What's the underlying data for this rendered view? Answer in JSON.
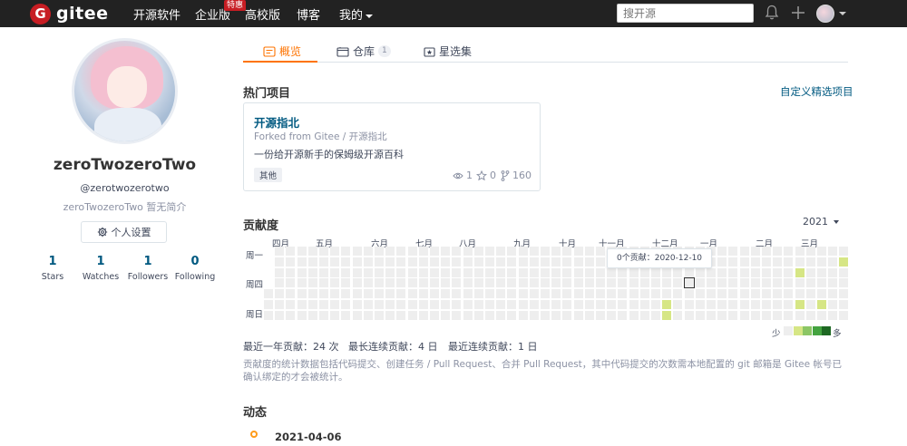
{
  "nav": {
    "logo_mark": "G",
    "logo_text": "gitee",
    "items": [
      "开源软件",
      "企业版",
      "高校版",
      "博客"
    ],
    "badge": "特惠",
    "mine": "我的",
    "search_placeholder": "搜开源"
  },
  "profile": {
    "name": "zeroTwozeroTwo",
    "handle": "@zerotwozerotwo",
    "bio": "zeroTwozeroTwo 暂无简介",
    "settings_label": "个人设置",
    "stats": [
      {
        "num": "1",
        "label": "Stars"
      },
      {
        "num": "1",
        "label": "Watches"
      },
      {
        "num": "1",
        "label": "Followers"
      },
      {
        "num": "0",
        "label": "Following"
      }
    ]
  },
  "tabs": {
    "overview": "概览",
    "repos": "仓库",
    "repos_count": "1",
    "collections": "星选集"
  },
  "hot": {
    "title": "热门项目",
    "custom_link": "自定义精选项目",
    "project": {
      "name": "开源指北",
      "fork": "Forked from Gitee  / 开源指北",
      "desc": "一份给开源新手的保姆级开源百科",
      "tag": "其他",
      "watches": "1",
      "stars": "0",
      "forks": "160"
    }
  },
  "contrib": {
    "title": "贡献度",
    "year": "2021",
    "months": [
      "四月",
      "五月",
      "六月",
      "七月",
      "八月",
      "九月",
      "十月",
      "十一月",
      "十二月",
      "一月",
      "二月",
      "三月"
    ],
    "weekdays": [
      "周一",
      "周四",
      "周日"
    ],
    "tooltip": "0个贡献：2020-12-10",
    "legend_less": "少",
    "legend_more": "多",
    "levels": [
      "#eeeeee",
      "#d6e685",
      "#8cc665",
      "#44a340",
      "#1e6823"
    ],
    "year_total": "最近一年贡献：24 次",
    "longest": "最长连续贡献：4 日",
    "current": "最近连续贡献：1 日",
    "note": "贡献度的统计数据包括代码提交、创建任务 / Pull Request、合并 Pull Request，其中代码提交的次数需本地配置的 git 邮箱是 Gitee 帐号已确认绑定的才会被统计。",
    "active_cells": [
      {
        "week": 36,
        "day": 5,
        "level": 1
      },
      {
        "week": 36,
        "day": 6,
        "level": 1
      },
      {
        "week": 48,
        "day": 2,
        "level": 1
      },
      {
        "week": 48,
        "day": 5,
        "level": 1
      },
      {
        "week": 50,
        "day": 5,
        "level": 1
      },
      {
        "week": 52,
        "day": 1,
        "level": 1
      }
    ],
    "selected_cell": {
      "week": 38,
      "day": 3
    }
  },
  "feed": {
    "title": "动态",
    "date": "2021-04-06"
  }
}
